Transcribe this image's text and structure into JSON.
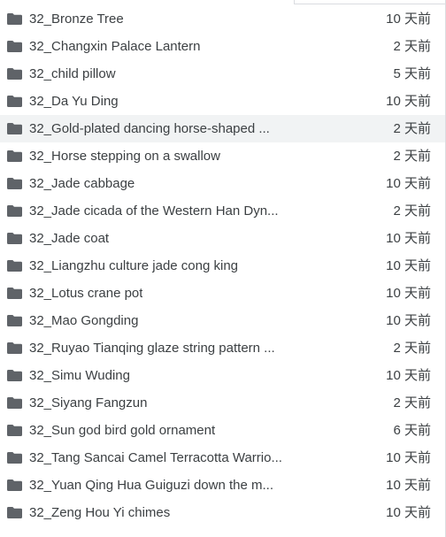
{
  "colors": {
    "folder_icon": "#5f6368",
    "text": "#3c4043",
    "hover_row": "#f1f3f4"
  },
  "file_list": {
    "hovered_index": 4,
    "rows": [
      {
        "icon": "folder-icon",
        "name": "32_Bronze Tree",
        "modified": "10 天前"
      },
      {
        "icon": "folder-icon",
        "name": "32_Changxin Palace Lantern",
        "modified": "2 天前"
      },
      {
        "icon": "folder-icon",
        "name": "32_child pillow",
        "modified": "5 天前"
      },
      {
        "icon": "folder-icon",
        "name": "32_Da Yu Ding",
        "modified": "10 天前"
      },
      {
        "icon": "folder-icon",
        "name": "32_Gold-plated dancing horse-shaped ...",
        "modified": "2 天前"
      },
      {
        "icon": "folder-icon",
        "name": "32_Horse stepping on a swallow",
        "modified": "2 天前"
      },
      {
        "icon": "folder-icon",
        "name": "32_Jade cabbage",
        "modified": "10 天前"
      },
      {
        "icon": "folder-icon",
        "name": "32_Jade cicada of the Western Han Dyn...",
        "modified": "2 天前"
      },
      {
        "icon": "folder-icon",
        "name": "32_Jade coat",
        "modified": "10 天前"
      },
      {
        "icon": "folder-icon",
        "name": "32_Liangzhu culture jade cong king",
        "modified": "10 天前"
      },
      {
        "icon": "folder-icon",
        "name": "32_Lotus crane pot",
        "modified": "10 天前"
      },
      {
        "icon": "folder-icon",
        "name": "32_Mao Gongding",
        "modified": "10 天前"
      },
      {
        "icon": "folder-icon",
        "name": "32_Ruyao Tianqing glaze string pattern ...",
        "modified": "2 天前"
      },
      {
        "icon": "folder-icon",
        "name": "32_Simu Wuding",
        "modified": "10 天前"
      },
      {
        "icon": "folder-icon",
        "name": "32_Siyang Fangzun",
        "modified": "2 天前"
      },
      {
        "icon": "folder-icon",
        "name": "32_Sun god bird gold ornament",
        "modified": "6 天前"
      },
      {
        "icon": "folder-icon",
        "name": "32_Tang Sancai Camel Terracotta Warrio...",
        "modified": "10 天前"
      },
      {
        "icon": "folder-icon",
        "name": "32_Yuan Qing Hua Guiguzi down the m...",
        "modified": "10 天前"
      },
      {
        "icon": "folder-icon",
        "name": "32_Zeng Hou Yi chimes",
        "modified": "10 天前"
      }
    ]
  }
}
